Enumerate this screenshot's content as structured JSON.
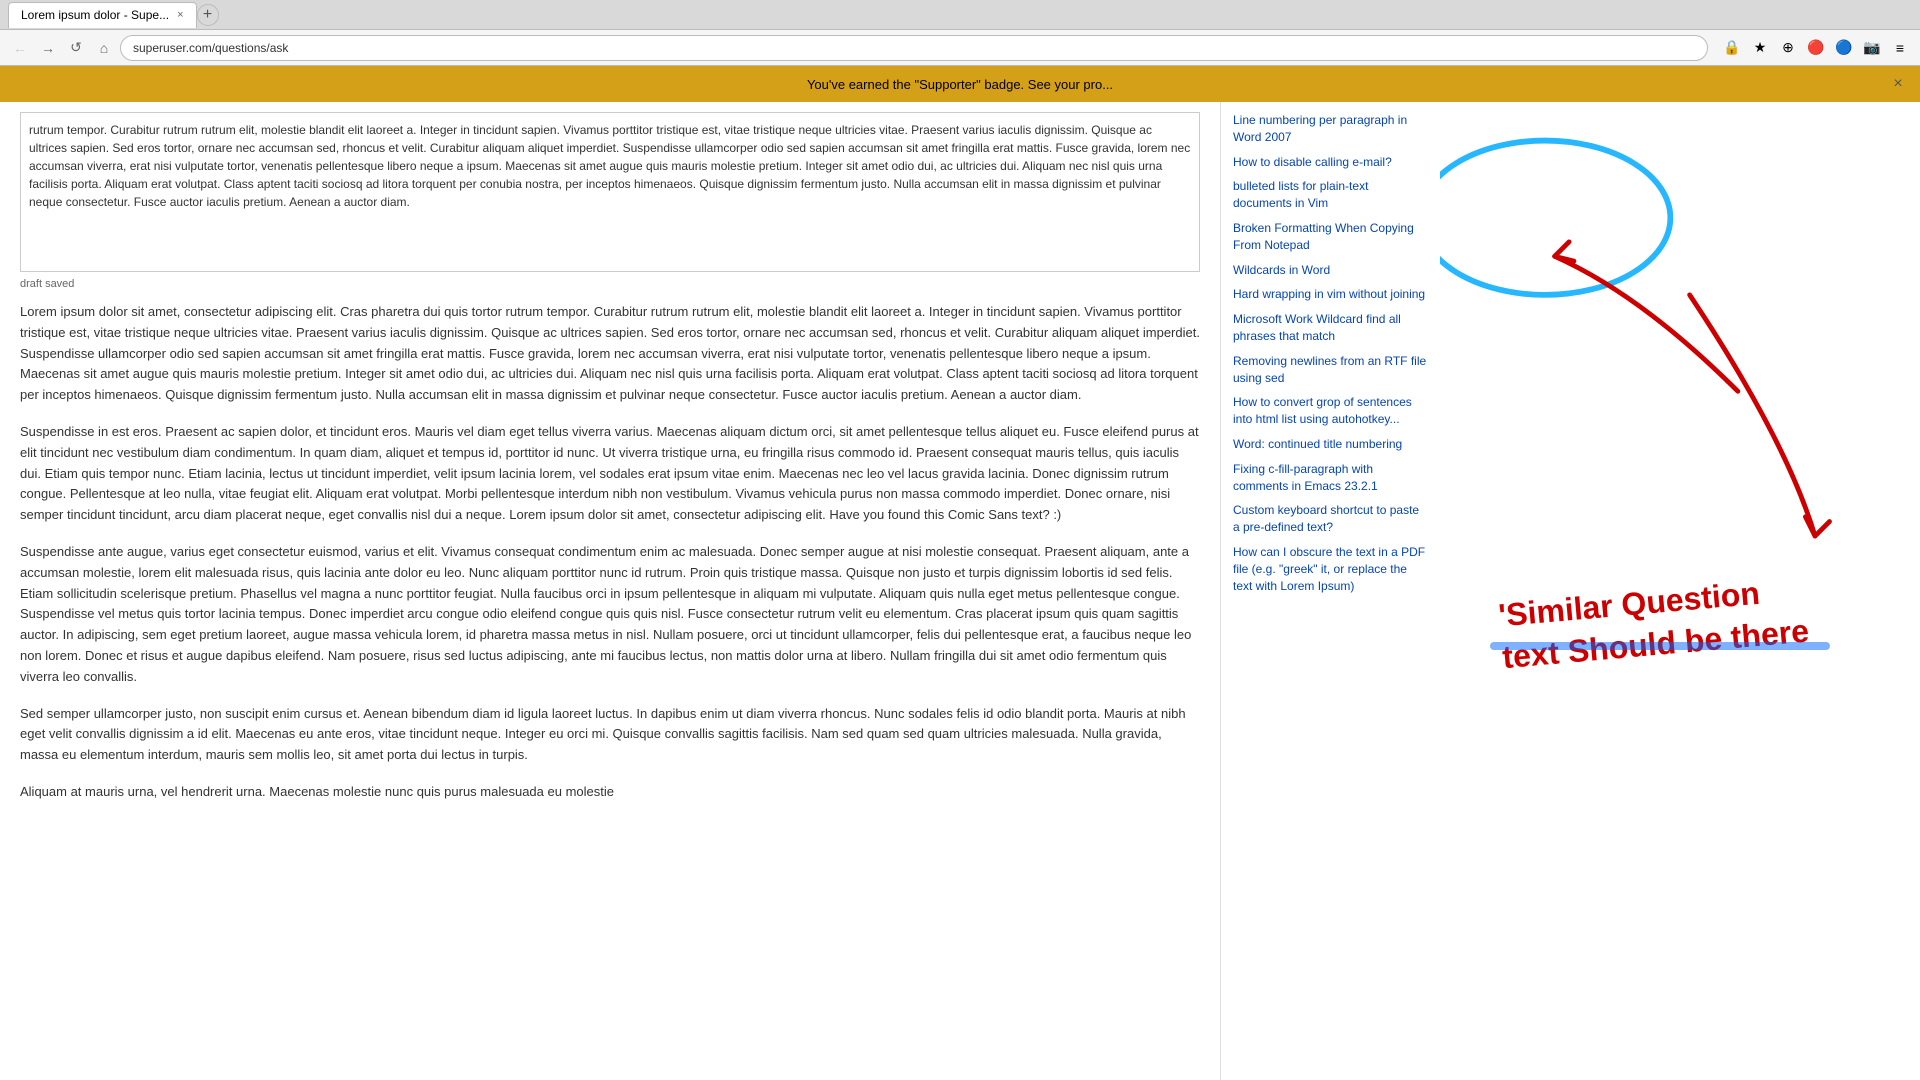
{
  "browser": {
    "tab_title": "Lorem ipsum dolor - Supe...",
    "tab_close": "×",
    "tab_new": "+",
    "nav_back": "←",
    "nav_forward": "→",
    "nav_reload": "↺",
    "nav_home": "⌂",
    "address": "superuser.com/questions/ask",
    "nav_icons": [
      "🔒",
      "★",
      "⊕",
      "🔴",
      "🔵",
      "📷",
      "≡"
    ]
  },
  "notification": {
    "text": "You've earned the \"Supporter\" badge. See your pro...",
    "close": "×"
  },
  "editor": {
    "content": "rutrum tempor. Curabitur rutrum rutrum elit, molestie blandit elit laoreet a. Integer in tincidunt sapien. Vivamus porttitor tristique est, vitae tristique neque ultricies vitae. Praesent varius iaculis dignissim. Quisque ac ultrices sapien. Sed eros tortor, ornare nec accumsan sed, rhoncus et velit. Curabitur aliquam aliquet imperdiet. Suspendisse ullamcorper odio sed sapien accumsan sit amet fringilla erat mattis. Fusce gravida, lorem nec accumsan viverra, erat nisi vulputate tortor, venenatis pellentesque libero neque a ipsum. Maecenas sit amet augue quis mauris molestie pretium. Integer sit amet odio dui, ac ultricies dui. Aliquam nec nisl quis urna facilisis porta. Aliquam erat volutpat. Class aptent taciti sociosq ad litora torquent per conubia nostra, per inceptos himenaeos. Quisque dignissim fermentum justo. Nulla accumsan elit in massa dignissim et pulvinar neque consectetur. Fusce auctor iaculis pretium. Aenean a auctor diam.",
    "draft_saved": "draft saved"
  },
  "paragraphs": [
    {
      "id": 1,
      "text": "Lorem ipsum dolor sit amet, consectetur adipiscing elit. Cras pharetra dui quis tortor rutrum tempor. Curabitur rutrum rutrum elit, molestie blandit elit laoreet a. Integer in tincidunt sapien. Vivamus porttitor tristique est, vitae tristique neque ultricies vitae. Praesent varius iaculis dignissim. Quisque ac ultrices sapien. Sed eros tortor, ornare nec accumsan sed, rhoncus et velit. Curabitur aliquam aliquet imperdiet. Suspendisse ullamcorper odio sed sapien accumsan sit amet fringilla erat mattis. Fusce gravida, lorem nec accumsan viverra, erat nisi vulputate tortor, venenatis pellentesque libero neque a ipsum. Maecenas sit amet augue quis mauris molestie pretium. Integer sit amet odio dui, ac ultricies dui. Aliquam nec nisl quis urna facilisis porta. Aliquam erat volutpat. Class aptent taciti sociosq ad litora torquent per inceptos himenaeos. Quisque dignissim fermentum justo. Nulla accumsan elit in massa dignissim et pulvinar neque consectetur. Fusce auctor iaculis pretium. Aenean a auctor diam."
    },
    {
      "id": 2,
      "text": "Suspendisse in est eros. Praesent ac sapien dolor, et tincidunt eros. Mauris vel diam eget tellus viverra varius. Maecenas aliquam dictum orci, sit amet pellentesque tellus aliquet eu. Fusce eleifend purus at elit tincidunt nec vestibulum diam condimentum. In quam diam, aliquet et tempus id, porttitor id nunc. Ut viverra tristique urna, eu fringilla risus commodo id. Praesent consequat mauris tellus, quis iaculis dui. Etiam quis tempor nunc. Etiam lacinia, lectus ut tincidunt imperdiet, velit ipsum lacinia lorem, vel sodales erat ipsum vitae enim. Maecenas nec leo vel lacus gravida lacinia. Donec dignissim rutrum congue. Pellentesque at leo nulla, vitae feugiat elit. Aliquam erat volutpat. Morbi pellentesque interdum nibh non vestibulum. Vivamus vehicula purus non massa commodo imperdiet. Donec ornare, nisi semper tincidunt tincidunt, arcu diam placerat neque, eget convallis nisl dui a neque. Lorem ipsum dolor sit amet, consectetur adipiscing elit. Have you found this Comic Sans text? :)"
    },
    {
      "id": 3,
      "text": "Suspendisse ante augue, varius eget consectetur euismod, varius et elit. Vivamus consequat condimentum enim ac malesuada. Donec semper augue at nisi molestie consequat. Praesent aliquam, ante a accumsan molestie, lorem elit malesuada risus, quis lacinia ante dolor eu leo. Nunc aliquam porttitor nunc id rutrum. Proin quis tristique massa. Quisque non justo et turpis dignissim lobortis id sed felis. Etiam sollicitudin scelerisque pretium. Phasellus vel magna a nunc porttitor feugiat. Nulla faucibus orci in ipsum pellentesque in aliquam mi vulputate. Aliquam quis nulla eget metus pellentesque congue. Suspendisse vel metus quis tortor lacinia tempus. Donec imperdiet arcu congue odio eleifend congue quis quis nisl. Fusce consectetur rutrum velit eu elementum. Cras placerat ipsum quis quam sagittis auctor. In adipiscing, sem eget pretium laoreet, augue massa vehicula lorem, id pharetra massa metus in nisl. Nullam posuere, orci ut tincidunt ullamcorper, felis dui pellentesque erat, a faucibus neque leo non lorem. Donec et risus et augue dapibus eleifend. Nam posuere, risus sed luctus adipiscing, ante mi faucibus lectus, non mattis dolor urna at libero. Nullam fringilla dui sit amet odio fermentum quis viverra leo convallis."
    },
    {
      "id": 4,
      "text": "Sed semper ullamcorper justo, non suscipit enim cursus et. Aenean bibendum diam id ligula laoreet luctus. In dapibus enim ut diam viverra rhoncus. Nunc sodales felis id odio blandit porta. Mauris at nibh eget velit convallis dignissim a id elit. Maecenas eu ante eros, vitae tincidunt neque. Integer eu orci mi. Quisque convallis sagittis facilisis. Nam sed quam sed quam ultricies malesuada. Nulla gravida, massa eu elementum interdum, mauris sem mollis leo, sit amet porta dui lectus in turpis."
    },
    {
      "id": 5,
      "text": "Aliquam at mauris urna, vel hendrerit urna. Maecenas molestie nunc quis purus malesuada eu molestie"
    }
  ],
  "sidebar": {
    "links": [
      {
        "id": 1,
        "text": "Line numbering per paragraph in Word 2007"
      },
      {
        "id": 2,
        "text": "How to disable calling e-mail?"
      },
      {
        "id": 3,
        "text": "bulleted lists for plain-text documents in Vim"
      },
      {
        "id": 4,
        "text": "Broken Formatting When Copying From Notepad"
      },
      {
        "id": 5,
        "text": "Wildcards in Word"
      },
      {
        "id": 6,
        "text": "Hard wrapping in vim without joining"
      },
      {
        "id": 7,
        "text": "Microsoft Work Wildcard find all phrases that match"
      },
      {
        "id": 8,
        "text": "Removing newlines from an RTF file using sed"
      },
      {
        "id": 9,
        "text": "How to convert grop of sentences into html list using autohotkey..."
      },
      {
        "id": 10,
        "text": "Word: continued title numbering"
      },
      {
        "id": 11,
        "text": "Fixing c-fill-paragraph with comments in Emacs 23.2.1"
      },
      {
        "id": 12,
        "text": "Custom keyboard shortcut to paste a pre-defined text?"
      },
      {
        "id": 13,
        "text": "How can I obscure the text in a PDF file (e.g. \"greek\" it, or replace the text with Lorem Ipsum)"
      }
    ]
  },
  "annotations": {
    "handwritten_line1": "'Similar Question",
    "handwritten_line2": "text Should be there",
    "arrow_color": "#cc0000",
    "circle_color": "#00aaff",
    "highlight_color": "#00aaff"
  }
}
